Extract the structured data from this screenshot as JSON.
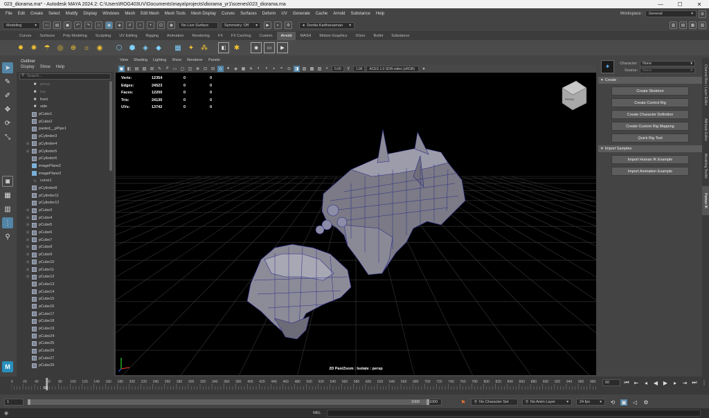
{
  "window": {
    "title": "023_diorama.ma* - Autodesk MAYA 2024.2: C:\\Users\\ROG403UV\\Documents\\maya\\projects\\diorama_yr1\\scenes\\023_diorama.ma",
    "minimize": "—",
    "maximize": "☐",
    "close": "✕"
  },
  "menubar": {
    "items": [
      "File",
      "Edit",
      "Create",
      "Select",
      "Modify",
      "Display",
      "Windows",
      "Mesh",
      "Edit Mesh",
      "Mesh Tools",
      "Mesh Display",
      "Curves",
      "Surfaces",
      "Deform",
      "UV",
      "Generate",
      "Cache",
      "Arnold",
      "Substance",
      "Help"
    ],
    "workspace_label": "Workspace :",
    "workspace_value": "General"
  },
  "statusline": {
    "mode": "Modeling",
    "live_surface": "No Live Surface",
    "symmetry": "Symmetry: Off",
    "user": "Dontia Kadharusman"
  },
  "shelf": {
    "tabs": [
      "Curves",
      "Surfaces",
      "Poly Modeling",
      "Sculpting",
      "UV Editing",
      "Rigging",
      "Animation",
      "Rendering",
      "FX",
      "FX Caching",
      "Custom",
      "Arnold",
      "MASH",
      "Motion Graphics",
      "XGen",
      "Bullet",
      "Substance"
    ],
    "active_tab": "Arnold"
  },
  "outliner": {
    "tab": "Outliner",
    "menus": [
      "Display",
      "Show",
      "Help"
    ],
    "search_placeholder": "Search...",
    "items": [
      {
        "name": "persp",
        "type": "cam",
        "dim": true,
        "exp": ""
      },
      {
        "name": "top",
        "type": "cam",
        "dim": true,
        "exp": ""
      },
      {
        "name": "front",
        "type": "cam",
        "dim": false,
        "exp": ""
      },
      {
        "name": "side",
        "type": "cam",
        "dim": false,
        "exp": ""
      },
      {
        "name": "pCube1",
        "type": "mesh",
        "dim": false,
        "exp": ""
      },
      {
        "name": "pCube2",
        "type": "mesh",
        "dim": false,
        "exp": ""
      },
      {
        "name": "pasted__pPipe1",
        "type": "mesh",
        "dim": false,
        "exp": ""
      },
      {
        "name": "pCylinder3",
        "type": "mesh",
        "dim": false,
        "exp": ""
      },
      {
        "name": "pCylinder4",
        "type": "mesh",
        "dim": false,
        "exp": "⊞"
      },
      {
        "name": "pCylinder5",
        "type": "mesh",
        "dim": false,
        "exp": "⊞"
      },
      {
        "name": "pCylinder6",
        "type": "mesh",
        "dim": false,
        "exp": ""
      },
      {
        "name": "imagePlane2",
        "type": "plane",
        "dim": false,
        "exp": ""
      },
      {
        "name": "imagePlane3",
        "type": "plane",
        "dim": false,
        "exp": ""
      },
      {
        "name": "curve1",
        "type": "curve",
        "dim": false,
        "exp": ""
      },
      {
        "name": "pCylinder8",
        "type": "mesh",
        "dim": false,
        "exp": ""
      },
      {
        "name": "pCylinder11",
        "type": "mesh",
        "dim": false,
        "exp": ""
      },
      {
        "name": "pCylinder12",
        "type": "mesh",
        "dim": false,
        "exp": ""
      },
      {
        "name": "pCube3",
        "type": "mesh",
        "dim": false,
        "exp": "⊞"
      },
      {
        "name": "pCube4",
        "type": "mesh",
        "dim": false,
        "exp": "⊞"
      },
      {
        "name": "pCube5",
        "type": "mesh",
        "dim": false,
        "exp": "⊞"
      },
      {
        "name": "pCube6",
        "type": "mesh",
        "dim": false,
        "exp": "⊞"
      },
      {
        "name": "pCube7",
        "type": "mesh",
        "dim": false,
        "exp": "⊞"
      },
      {
        "name": "pCube8",
        "type": "mesh",
        "dim": false,
        "exp": "⊞"
      },
      {
        "name": "pCube9",
        "type": "mesh",
        "dim": false,
        "exp": "⊞"
      },
      {
        "name": "pCube10",
        "type": "mesh",
        "dim": false,
        "exp": "⊞"
      },
      {
        "name": "pCube11",
        "type": "mesh",
        "dim": false,
        "exp": "⊞"
      },
      {
        "name": "pCube12",
        "type": "mesh",
        "dim": false,
        "exp": "⊞"
      },
      {
        "name": "pCube13",
        "type": "mesh",
        "dim": false,
        "exp": ""
      },
      {
        "name": "pCube14",
        "type": "mesh",
        "dim": false,
        "exp": ""
      },
      {
        "name": "pCube15",
        "type": "mesh",
        "dim": false,
        "exp": ""
      },
      {
        "name": "pCube16",
        "type": "mesh",
        "dim": false,
        "exp": ""
      },
      {
        "name": "pCube17",
        "type": "mesh",
        "dim": false,
        "exp": ""
      },
      {
        "name": "pCube18",
        "type": "mesh",
        "dim": false,
        "exp": ""
      },
      {
        "name": "pCube19",
        "type": "mesh",
        "dim": false,
        "exp": ""
      },
      {
        "name": "pCube24",
        "type": "mesh",
        "dim": false,
        "exp": ""
      },
      {
        "name": "pCube25",
        "type": "mesh",
        "dim": false,
        "exp": ""
      },
      {
        "name": "pCube26",
        "type": "mesh",
        "dim": false,
        "exp": ""
      },
      {
        "name": "pCube27",
        "type": "mesh",
        "dim": false,
        "exp": ""
      },
      {
        "name": "pCube29",
        "type": "mesh",
        "dim": false,
        "exp": ""
      }
    ]
  },
  "viewport": {
    "menus": [
      "View",
      "Shading",
      "Lighting",
      "Show",
      "Renderer",
      "Panels"
    ],
    "exposure": "0.00",
    "gamma": "1.00",
    "color_space": "ACES 1.0 SDR-video (sRGB)",
    "camera_label": "2D Pan/Zoom : Isolate : persp",
    "viewcube_label": "FRONT",
    "hud": [
      {
        "label": "Verts:",
        "value": "12354",
        "c1": "0",
        "c2": "0"
      },
      {
        "label": "Edges:",
        "value": "24523",
        "c1": "0",
        "c2": "0"
      },
      {
        "label": "Faces:",
        "value": "12200",
        "c1": "0",
        "c2": "0"
      },
      {
        "label": "Tris:",
        "value": "24130",
        "c1": "0",
        "c2": "0"
      },
      {
        "label": "UVs:",
        "value": "13742",
        "c1": "0",
        "c2": "0"
      }
    ]
  },
  "humanik": {
    "character_label": "Character:",
    "character_value": "None",
    "source_label": "Source:",
    "source_value": "None",
    "create_section": "Create",
    "create_buttons": [
      "Create Skeleton",
      "Create Control Rig",
      "Create Character Definition",
      "Create Custom Rig Mapping",
      "Quick Rig Tool"
    ],
    "import_section": "Import Samples",
    "import_buttons": [
      "Import Human IK Example",
      "Import Animation Example"
    ]
  },
  "side_tabs": [
    "Channel Box / Layer Editor",
    "Attribute Editor",
    "Modeling Toolkit",
    "Human IK"
  ],
  "timeline": {
    "ticks": [
      "0",
      "20",
      "40",
      "60",
      "80",
      "100",
      "120",
      "140",
      "160",
      "180",
      "200",
      "220",
      "240",
      "260",
      "280",
      "300",
      "320",
      "340",
      "360",
      "380",
      "400",
      "420",
      "440",
      "460",
      "480",
      "500",
      "520",
      "540",
      "560",
      "580",
      "600",
      "620",
      "640",
      "660",
      "680",
      "700",
      "720",
      "740",
      "760",
      "780",
      "800",
      "820",
      "840",
      "860",
      "880",
      "900",
      "920",
      "940",
      "960",
      "980"
    ],
    "current_frame": "60",
    "current_frame_field": "60"
  },
  "range": {
    "start": "1",
    "playback_start": "1",
    "playback_end": "1000",
    "end": "1000",
    "character_set": "No Character Set",
    "anim_layer": "No Anim Layer",
    "fps": "24 fps"
  },
  "cmdline": {
    "label": "MEL"
  }
}
